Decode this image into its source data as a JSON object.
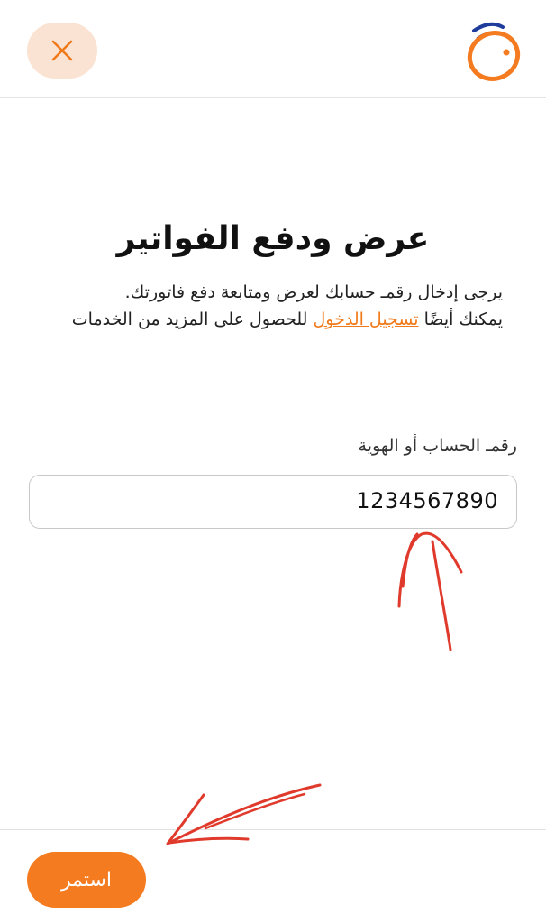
{
  "header": {
    "close_icon": "close-icon",
    "logo": "brand-logo"
  },
  "main": {
    "title": "عرض ودفع الفواتير",
    "description_line1": "يرجى إدخال رقمـ حسابك لعرض ومتابعة دفع فاتورتك.",
    "description_part2_before": "يمكنك أيضًا ",
    "description_link": "تسجيل الدخول",
    "description_part2_after": " للحصول على المزيد من الخدمات"
  },
  "form": {
    "account_label": "رقمـ الحساب أو الهوية",
    "account_value": "1234567890"
  },
  "footer": {
    "continue_label": "استمر"
  },
  "colors": {
    "accent": "#f47b20",
    "close_bg": "#fbe3d3",
    "annotation": "#e03a2c"
  }
}
